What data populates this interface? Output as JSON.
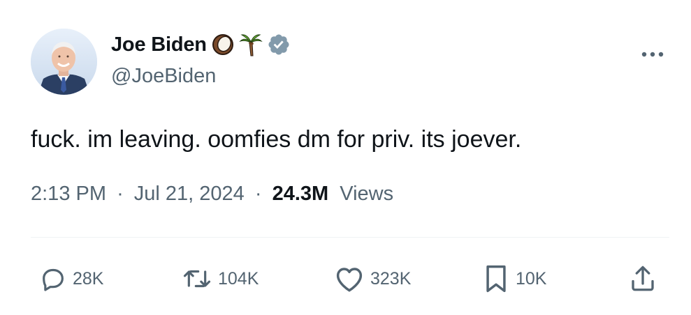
{
  "author": {
    "display_name": "Joe Biden",
    "handle": "@JoeBiden",
    "name_emojis": [
      "coconut-icon",
      "palm-tree-icon"
    ],
    "verified": true,
    "verified_color": "#829aab"
  },
  "tweet": {
    "text": "fuck. im leaving. oomfies dm for priv. its joever.",
    "time": "2:13 PM",
    "separator": "·",
    "date": "Jul 21, 2024",
    "views_count": "24.3M",
    "views_label": "Views"
  },
  "actions": {
    "reply": {
      "icon": "reply-icon",
      "count": "28K"
    },
    "retweet": {
      "icon": "retweet-icon",
      "count": "104K"
    },
    "like": {
      "icon": "heart-icon",
      "count": "323K"
    },
    "bookmark": {
      "icon": "bookmark-icon",
      "count": "10K"
    },
    "share": {
      "icon": "share-icon"
    }
  },
  "more": {
    "icon": "more-icon"
  },
  "colors": {
    "text_primary": "#0f1419",
    "text_secondary": "#536471",
    "divider": "#eff3f4"
  }
}
